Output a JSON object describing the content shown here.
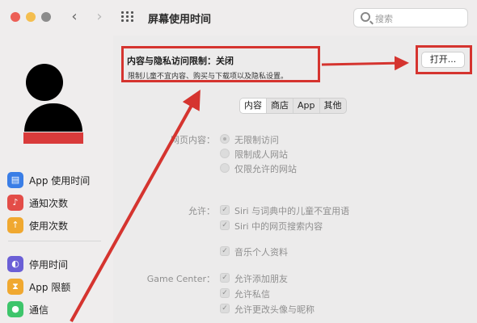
{
  "toolbar": {
    "back_glyph": "‹",
    "forward_glyph": "›",
    "title": "屏幕使用时间",
    "search_placeholder": "搜索"
  },
  "sidebar": {
    "items": [
      {
        "label": "App 使用时间",
        "icon": "hourglass-chart-icon",
        "color": "#3a7ee6"
      },
      {
        "label": "通知次数",
        "icon": "bell-icon",
        "color": "#e34d48"
      },
      {
        "label": "使用次数",
        "icon": "pickup-icon",
        "color": "#f0a830"
      },
      {
        "label": "停用时间",
        "icon": "moon-clock-icon",
        "color": "#6b5fd6"
      },
      {
        "label": "App 限额",
        "icon": "hourglass-icon",
        "color": "#f0a830"
      },
      {
        "label": "通信",
        "icon": "contacts-icon",
        "color": "#3ec56b"
      }
    ]
  },
  "panel": {
    "title": "内容与隐私访问限制：关闭",
    "subtitle": "限制儿童不宜内容、购买与下载项以及隐私设置。",
    "open_button": "打开..."
  },
  "tabs": [
    "内容",
    "商店",
    "App",
    "其他"
  ],
  "web_content": {
    "label": "网页内容：",
    "options": [
      {
        "text": "无限制访问",
        "selected": true
      },
      {
        "text": "限制成人网站",
        "selected": false
      },
      {
        "text": "仅限允许的网站",
        "selected": false
      }
    ]
  },
  "allow": {
    "label": "允许：",
    "items": [
      {
        "text": "Siri 与词典中的儿童不宜用语",
        "checked": true
      },
      {
        "text": "Siri 中的网页搜索内容",
        "checked": true
      },
      {
        "text": "音乐个人资料",
        "checked": true
      }
    ]
  },
  "game_center": {
    "label": "Game Center：",
    "items": [
      {
        "text": "允许添加朋友",
        "checked": true
      },
      {
        "text": "允许私信",
        "checked": true
      },
      {
        "text": "允许更改头像与昵称",
        "checked": true
      }
    ]
  },
  "check_glyph": "✓",
  "accent": {
    "highlight_red": "#d5342f"
  }
}
